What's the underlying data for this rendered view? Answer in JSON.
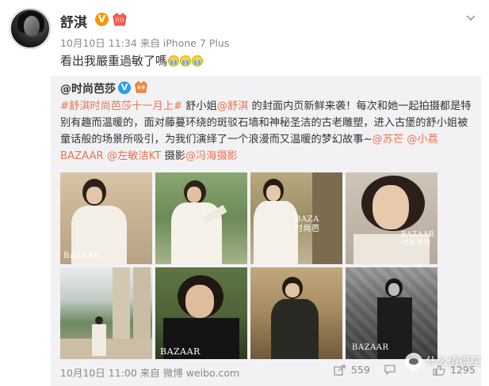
{
  "post": {
    "username": "舒淇",
    "verified_badge": "V",
    "meta": "10月10日 11:34 来自 iPhone 7 Plus",
    "text": "看出我嚴重過敏了嗎",
    "emoji_count": 3
  },
  "repost": {
    "username": "@时尚芭莎",
    "verified_badge": "V",
    "body_parts": {
      "hashtag": "#舒淇时尚芭莎十一月上#",
      "text1": " 舒小姐",
      "mention1": "@舒淇",
      "text2": " 的封面内页新鲜来袭！每次和她一起拍摄都是特别有趣而温暖的，面对藤蔓环绕的斑驳石墙和神秘圣洁的古老雕塑，进入古堡的舒小姐被童话般的场景所吸引，为我们演绎了一个浪漫而又温暖的梦幻故事~",
      "mention2": "@苏芒",
      "text3": " ",
      "mention3": "@小荔BAZAAR",
      "text4": " ",
      "mention4": "@左敏洁KT",
      "text5": " 摄影",
      "mention5": "@冯海摄影"
    },
    "photos": [
      {
        "name": "photo-1",
        "brand": "BAZAAR"
      },
      {
        "name": "photo-2",
        "brand": ""
      },
      {
        "name": "photo-3",
        "brand": "BAZA 时尚芭"
      },
      {
        "name": "photo-4",
        "brand": "BAZAAR 时尚芭莎"
      },
      {
        "name": "photo-5",
        "brand": ""
      },
      {
        "name": "photo-6",
        "brand": "BAZAAR"
      },
      {
        "name": "photo-7",
        "brand": ""
      },
      {
        "name": "photo-8",
        "brand": "BAZAAR"
      }
    ],
    "footer": {
      "meta": "10月10日 11:00 来自 微博 weibo.com",
      "share_count": "559",
      "like_count": "1295"
    }
  },
  "watermark": {
    "text": "什么值得买"
  },
  "colors": {
    "link": "#eb7350",
    "verified_orange": "#f39a00",
    "verified_blue": "#2a9be8",
    "repost_bg": "#f2f2f5"
  }
}
